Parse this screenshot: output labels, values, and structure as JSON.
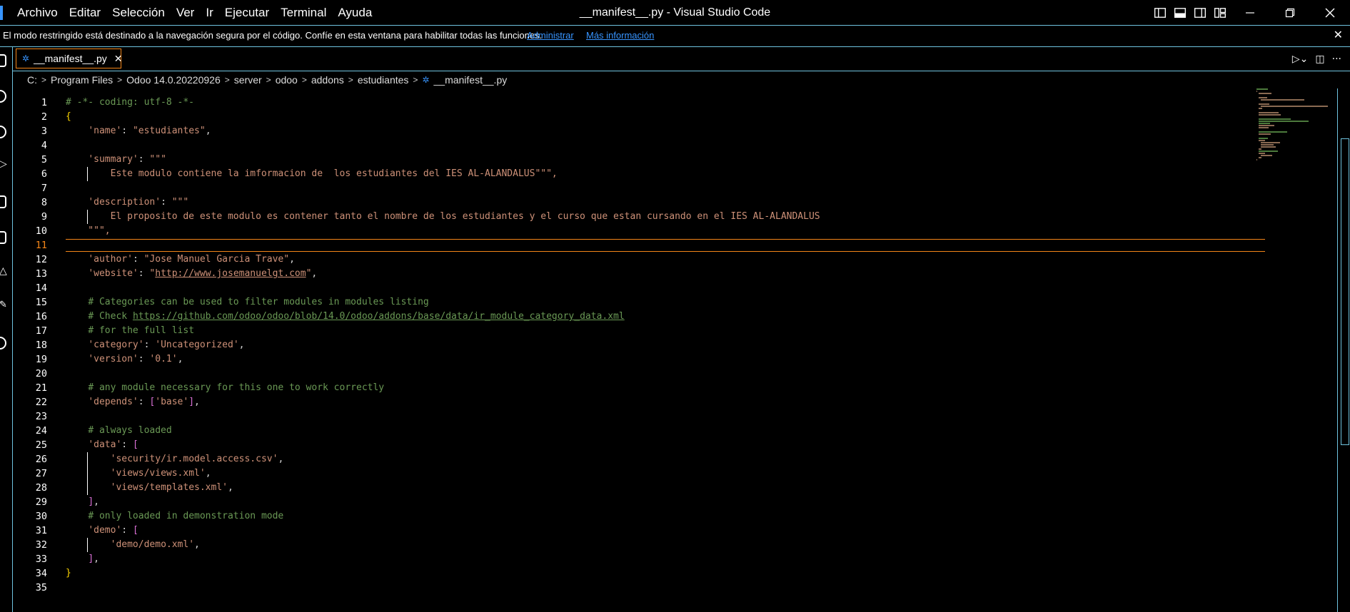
{
  "window": {
    "title": "__manifest__.py - Visual Studio Code"
  },
  "menu": [
    "Archivo",
    "Editar",
    "Selección",
    "Ver",
    "Ir",
    "Ejecutar",
    "Terminal",
    "Ayuda"
  ],
  "banner": {
    "message": "El modo restringido está destinado a la navegación segura por el código. Confíe en esta ventana para habilitar todas las funciones.",
    "manage_link": "Administrar",
    "more_link": "Más información"
  },
  "tab": {
    "label": "__manifest__.py"
  },
  "breadcrumb": [
    "C:",
    "Program Files",
    "Odoo 14.0.20220926",
    "server",
    "odoo",
    "addons",
    "estudiantes",
    "__manifest__.py"
  ],
  "editor": {
    "current_line": 11,
    "lines": [
      "# -*- coding: utf-8 -*-",
      "{",
      "    'name': \"estudiantes\",",
      "",
      "    'summary': \"\"\"",
      "        Este modulo contiene la imformacion de  los estudiantes del IES AL-ALANDALUS\"\"\",",
      "",
      "    'description': \"\"\"",
      "        El proposito de este modulo es contener tanto el nombre de los estudiantes y el curso que estan cursando en el IES AL-ALANDALUS",
      "    \"\"\",",
      "",
      "    'author': \"Jose Manuel Garcia Trave\",",
      "    'website': \"http://www.josemanuelgt.com\",",
      "",
      "    # Categories can be used to filter modules in modules listing",
      "    # Check https://github.com/odoo/odoo/blob/14.0/odoo/addons/base/data/ir_module_category_data.xml",
      "    # for the full list",
      "    'category': 'Uncategorized',",
      "    'version': '0.1',",
      "",
      "    # any module necessary for this one to work correctly",
      "    'depends': ['base'],",
      "",
      "    # always loaded",
      "    'data': [",
      "        'security/ir.model.access.csv',",
      "        'views/views.xml',",
      "        'views/templates.xml',",
      "    ],",
      "    # only loaded in demonstration mode",
      "    'demo': [",
      "        'demo/demo.xml',",
      "    ],",
      "}",
      ""
    ]
  },
  "colors": {
    "accent": "#6fc3df",
    "focus": "#f38518",
    "string": "#ce9178",
    "comment": "#6a9955",
    "bracket1": "#ffd700",
    "bracket2": "#da70d6"
  }
}
